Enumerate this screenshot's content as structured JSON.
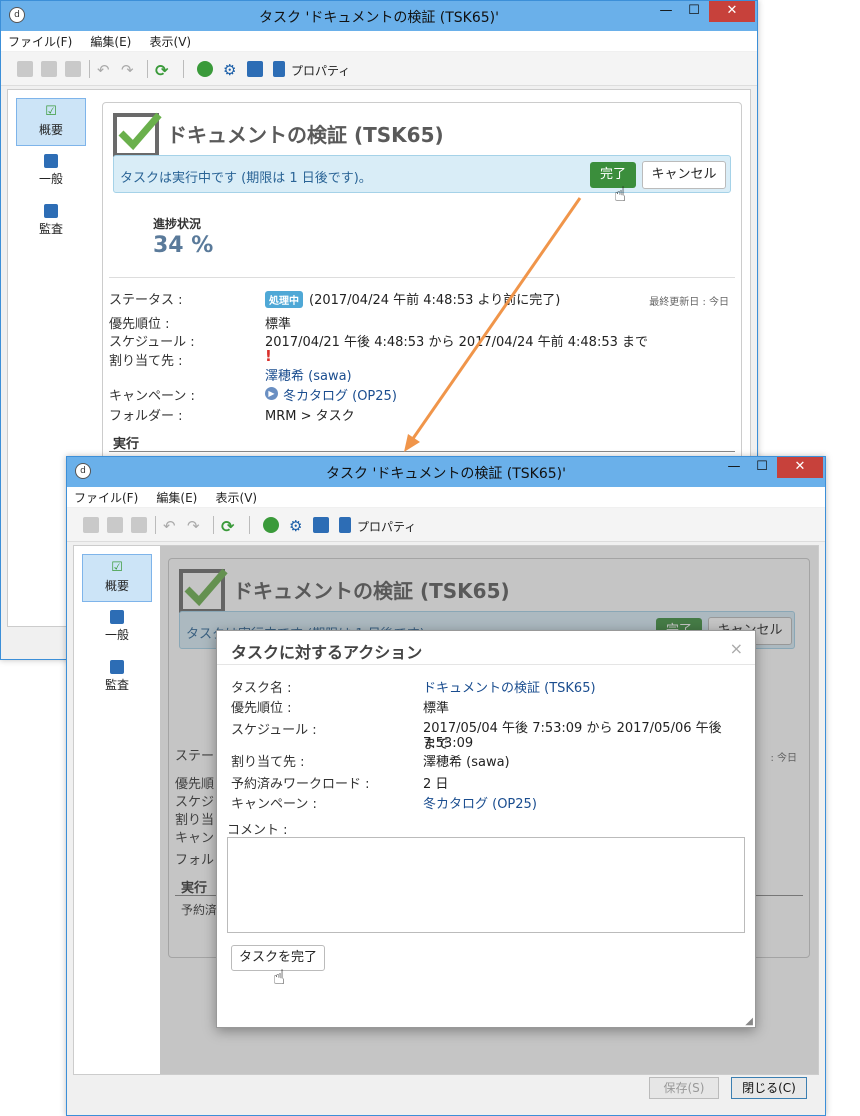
{
  "window": {
    "title": "タスク 'ドキュメントの検証 (TSK65)'",
    "controls": {
      "minimize": "—",
      "maximize": "☐",
      "close": "✕"
    },
    "menu": [
      "ファイル(F)",
      "編集(E)",
      "表示(V)"
    ],
    "toolbar_properties": "プロパティ"
  },
  "sidebar": [
    {
      "label": "概要",
      "icon": "checkbox-icon"
    },
    {
      "label": "一般",
      "icon": "clipboard-icon"
    },
    {
      "label": "監査",
      "icon": "audit-icon"
    }
  ],
  "task": {
    "heading": "ドキュメントの検証 (TSK65)",
    "banner_text": "タスクは実行中です (期限は 1 日後です)。",
    "complete_button": "完了",
    "cancel_button": "キャンセル",
    "progress_label": "進捗状況",
    "progress_value": "34 %",
    "last_updated": "最終更新日 : 今日",
    "section_execution": "実行",
    "fields": {
      "status_label": "ステータス :",
      "status_badge": "処理中",
      "status_value": "(2017/04/24 午前 4:48:53 より前に完了)",
      "priority_label": "優先順位 :",
      "priority_value": "標準",
      "schedule_label": "スケジュール :",
      "schedule_value": "2017/04/21 午後 4:48:53 から 2017/04/24 午前 4:48:53 まで",
      "assignee_label": "割り当て先 :",
      "assignee_value": "澤穂希 (sawa)",
      "campaign_label": "キャンペーン :",
      "campaign_value": "冬カタログ (OP25)",
      "folder_label": "フォルダー :",
      "folder_value": "MRM > タスク"
    }
  },
  "back_fragments": {
    "status": "ステー",
    "priority": "優先順",
    "schedule": "スケジ",
    "assign": "割り当",
    "campaign": "キャン",
    "folder": "フォル",
    "execution": "実行",
    "reserved": "予約済",
    "last_updated_tail": ": 今日",
    "banner_peek": "タスクは実行中です (期限は 1 日後です)。",
    "complete_peek": "完了",
    "cancel_peek": "キャンセル"
  },
  "dialog": {
    "title": "タスクに対するアクション",
    "close": "×",
    "rows": [
      {
        "label": "タスク名 :",
        "value": "ドキュメントの検証 (TSK65)",
        "link": true
      },
      {
        "label": "優先順位 :",
        "value": "標準",
        "link": false
      },
      {
        "label": "スケジュール :",
        "value": "2017/05/04 午後 7:53:09 から 2017/05/06 午後 7:53:09",
        "value2": "まで",
        "link": false
      },
      {
        "label": "割り当て先 :",
        "value": "澤穂希 (sawa)",
        "link": false
      },
      {
        "label": "予約済みワークロード :",
        "value": "2 日",
        "link": false
      },
      {
        "label": "キャンペーン :",
        "value": "冬カタログ (OP25)",
        "link": true
      }
    ],
    "comment_label": "コメント :",
    "comment_value": "",
    "complete_task_button": "タスクを完了"
  },
  "footer": {
    "save_button": "保存(S)",
    "close_button": "閉じる(C)"
  },
  "colors": {
    "accent": "#3b8e3c",
    "link": "#1a4d8f",
    "arrow": "#f0954a",
    "titlebar": "#6ab0ea"
  }
}
